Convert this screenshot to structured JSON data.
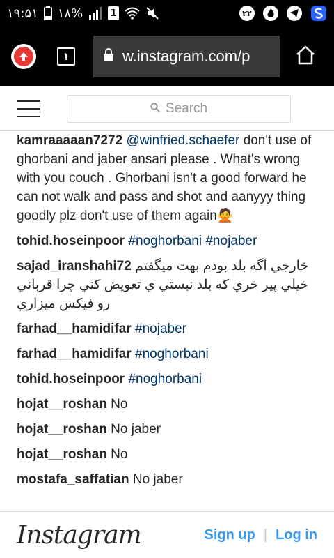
{
  "status": {
    "time": "۱۹:۵۱",
    "battery": "۱۸%",
    "sim_badge": "1",
    "notification_count": "۲۲"
  },
  "browser": {
    "tab_count": "۱",
    "url": "w.instagram.com/p"
  },
  "header": {
    "search_placeholder": "Search"
  },
  "comments": [
    {
      "user": "kamraaaaan7272",
      "mention": "@winfried.schaefer",
      "text": " don't use of ghorbani and jaber ansari please . What's wrong with you couch . Ghorbani isn't a good forward he can not walk and pass and shot and aanyyy thing goodly plz don't use of them again🙅"
    },
    {
      "user": "tohid.hoseinpoor",
      "tags": "#noghorbani #nojaber"
    },
    {
      "user": "sajad_iranshahi72",
      "text": "خارجي اگه بلد بودم بهت ميگفتم خيلي پير خري كه بلد نبستي ي تعويض كني چرا قرباني رو فيكس ميزاري"
    },
    {
      "user": "farhad__hamidifar",
      "tags": "#nojaber"
    },
    {
      "user": "farhad__hamidifar",
      "tags": "#noghorbani"
    },
    {
      "user": "tohid.hoseinpoor",
      "tags": "#noghorbani"
    },
    {
      "user": "hojat__roshan",
      "text": "No"
    },
    {
      "user": "hojat__roshan",
      "text": "No jaber"
    },
    {
      "user": "hojat__roshan",
      "text": "No"
    },
    {
      "user": "mostafa_saffatian",
      "text": "No jaber"
    }
  ],
  "footer": {
    "logo": "Instagram",
    "signup_label": "Sign up",
    "separator": "|",
    "login_label": "Log in"
  }
}
